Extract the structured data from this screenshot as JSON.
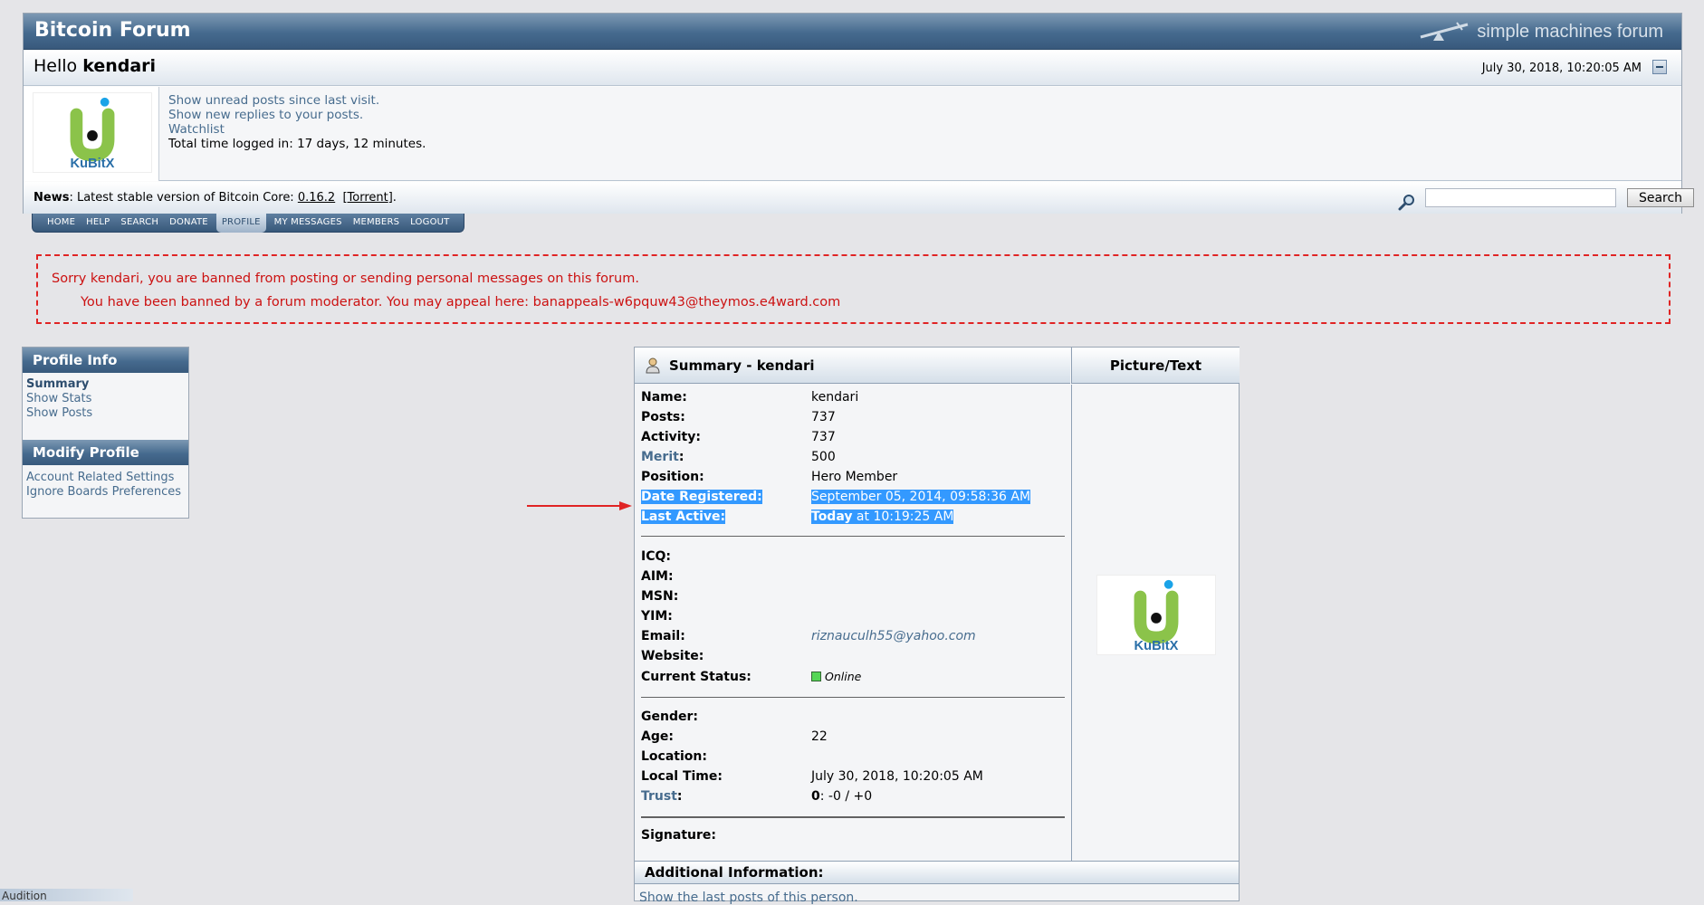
{
  "header": {
    "forum_title": "Bitcoin Forum",
    "smf_brand": "simple machines forum",
    "hello_prefix": "Hello",
    "username": "kendari",
    "datetime": "July 30, 2018, 10:20:05 AM"
  },
  "user_panel": {
    "links": [
      "Show unread posts since last visit.",
      "Show new replies to your posts.",
      "Watchlist"
    ],
    "total_time": "Total time logged in: 17 days, 12 minutes."
  },
  "news": {
    "label": "News",
    "text": ": Latest stable version of Bitcoin Core: ",
    "version": "0.16.2",
    "torrent": "Torrent",
    "search_button": "Search",
    "search_value": ""
  },
  "nav": {
    "items": [
      "HOME",
      "HELP",
      "SEARCH",
      "DONATE",
      "PROFILE",
      "MY MESSAGES",
      "MEMBERS",
      "LOGOUT"
    ],
    "active": "PROFILE"
  },
  "ban": {
    "line1": "Sorry kendari, you are banned from posting or sending personal messages on this forum.",
    "line2": "You have been banned by a forum moderator. You may appeal here: banappeals-w6pquw43@theymos.e4ward.com"
  },
  "sidebar": {
    "profile_info_title": "Profile Info",
    "profile_info_links": [
      "Summary",
      "Show Stats",
      "Show Posts"
    ],
    "modify_title": "Modify Profile",
    "modify_links": [
      "Account Related Settings",
      "Ignore Boards Preferences"
    ]
  },
  "profile": {
    "summary_title": "Summary - kendari",
    "picture_title": "Picture/Text",
    "rows": {
      "name_k": "Name:",
      "name_v": "kendari",
      "posts_k": "Posts:",
      "posts_v": "737",
      "activity_k": "Activity:",
      "activity_v": "737",
      "merit_k": "Merit",
      "merit_v": "500",
      "position_k": "Position:",
      "position_v": "Hero Member",
      "registered_k": "Date Registered:",
      "registered_v": "September 05, 2014, 09:58:36 AM",
      "active_k": "Last Active:",
      "active_v_bold": "Today",
      "active_v_rest": " at 10:19:25 AM",
      "icq_k": "ICQ:",
      "aim_k": "AIM:",
      "msn_k": "MSN:",
      "yim_k": "YIM:",
      "email_k": "Email:",
      "email_v": "riznauculh55@yahoo.com",
      "website_k": "Website:",
      "status_k": "Current Status:",
      "status_v": "Online",
      "gender_k": "Gender:",
      "age_k": "Age:",
      "age_v": "22",
      "location_k": "Location:",
      "localtime_k": "Local Time:",
      "localtime_v": "July 30, 2018, 10:20:05 AM",
      "trust_k": "Trust",
      "trust_v_bold": "0",
      "trust_v_rest": ": -0 / +0",
      "signature_k": "Signature:"
    },
    "additional_title": "Additional Information:",
    "last_posts_link": "Show the last posts of this person."
  },
  "avatar_logo_text": "KuBitX",
  "bottom_tab": "Audition",
  "colors": {
    "header_blue": "#456a8e",
    "link": "#476c8e",
    "ban_red": "#e02424",
    "highlight": "#3399ff",
    "logo_green": "#8bc34a",
    "logo_blue": "#1aa3e8"
  }
}
